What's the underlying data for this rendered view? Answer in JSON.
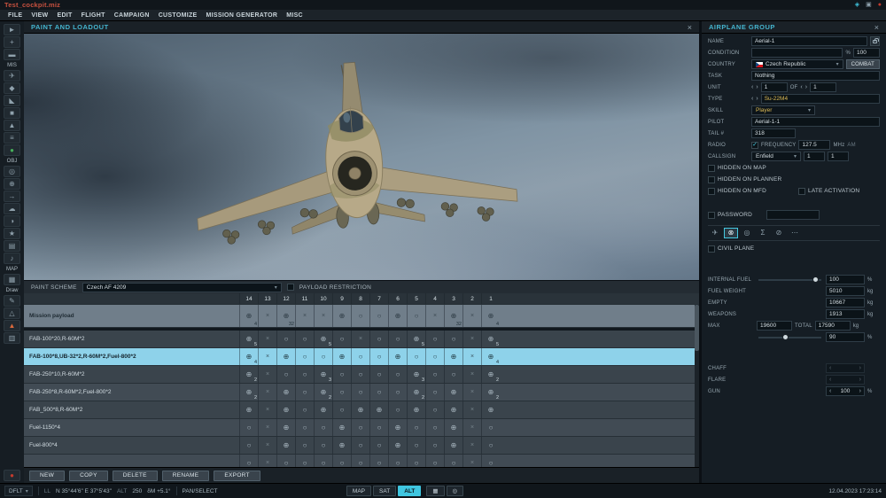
{
  "title_bar": {
    "title": "Test_cockpit.miz",
    "icons": [
      {
        "name": "network-status-icon",
        "glyph": "◈",
        "color": "#3fc6e0"
      },
      {
        "name": "voice-chat-icon",
        "glyph": "▣",
        "color": "#8fa1ac"
      },
      {
        "name": "record-indicator-icon",
        "glyph": "●",
        "color": "#c23b2e"
      }
    ]
  },
  "menu_bar": {
    "items": [
      "FILE",
      "VIEW",
      "EDIT",
      "FLIGHT",
      "CAMPAIGN",
      "CUSTOMIZE",
      "MISSION GENERATOR",
      "MISC"
    ]
  },
  "left_toolbar": {
    "items": [
      {
        "type": "icon",
        "name": "select-icon",
        "glyph": "►"
      },
      {
        "type": "icon",
        "name": "pan-icon",
        "glyph": "+"
      },
      {
        "type": "icon",
        "name": "ruler-icon",
        "glyph": "▬"
      },
      {
        "type": "label",
        "text": "MIS"
      },
      {
        "type": "icon",
        "name": "aircraft-icon",
        "glyph": "✈"
      },
      {
        "type": "icon",
        "name": "helicopter-icon",
        "glyph": "◆"
      },
      {
        "type": "icon",
        "name": "ship-icon",
        "glyph": "◣"
      },
      {
        "type": "icon",
        "name": "vehicle-icon",
        "glyph": "■"
      },
      {
        "type": "icon",
        "name": "static-object-icon",
        "glyph": "▲"
      },
      {
        "type": "icon",
        "name": "template-icon",
        "glyph": "≡"
      },
      {
        "type": "icon",
        "name": "play-icon",
        "glyph": "●",
        "color": "#46b05a"
      },
      {
        "type": "label",
        "text": "OBJ"
      },
      {
        "type": "icon",
        "name": "trigger-zone-icon",
        "glyph": "◎"
      },
      {
        "type": "icon",
        "name": "bullseye-icon",
        "glyph": "⊕"
      },
      {
        "type": "icon",
        "name": "route-icon",
        "glyph": "→"
      },
      {
        "type": "icon",
        "name": "weather-icon",
        "glyph": "☁"
      },
      {
        "type": "icon",
        "name": "time-icon",
        "glyph": "◑"
      },
      {
        "type": "icon",
        "name": "settings-icon",
        "glyph": "★"
      },
      {
        "type": "icon",
        "name": "briefing-icon",
        "glyph": "▤"
      },
      {
        "type": "icon",
        "name": "sound-icon",
        "glyph": "♪"
      },
      {
        "type": "label",
        "text": "MAP"
      },
      {
        "type": "icon",
        "name": "layers-icon",
        "glyph": "▦"
      },
      {
        "type": "label",
        "text": "Draw"
      },
      {
        "type": "icon",
        "name": "draw-pencil-icon",
        "glyph": "✎"
      },
      {
        "type": "icon",
        "name": "draw-shape-icon",
        "glyph": "△"
      },
      {
        "type": "icon",
        "name": "warning-icon",
        "glyph": "▲",
        "color": "#d8683c"
      },
      {
        "type": "icon",
        "name": "export-icon",
        "glyph": "▥"
      },
      {
        "type": "spacer"
      },
      {
        "type": "icon",
        "name": "record-icon",
        "glyph": "●",
        "color": "#c23b2e"
      }
    ]
  },
  "paint_panel": {
    "title": "PAINT AND LOADOUT",
    "paint_scheme_label": "PAINT SCHEME",
    "paint_scheme_value": "Czech AF 4209",
    "payload_restriction_label": "PAYLOAD RESTRICTION",
    "pylons": [
      "14",
      "13",
      "12",
      "11",
      "10",
      "9",
      "8",
      "7",
      "6",
      "5",
      "4",
      "3",
      "2",
      "1"
    ],
    "rows": [
      {
        "label": "Mission payload",
        "kind": "mission",
        "cells": [
          "w:4",
          "x",
          "w:32",
          "x",
          "x",
          "w",
          "c",
          "c",
          "w",
          "c",
          "x",
          "w:32",
          "x",
          "w:4"
        ]
      },
      {
        "label": "FAB-100*20,R-60M*2",
        "cells": [
          "w:5",
          "x",
          "c",
          "c",
          "w:5",
          "c",
          "x",
          "c",
          "c",
          "w:5",
          "c",
          "c",
          "x",
          "w:5"
        ]
      },
      {
        "label": "FAB-100*8,UB-32*2,R-60M*2,Fuel-800*2",
        "selected": true,
        "cells": [
          "w:4",
          "x",
          "w",
          "c",
          "c",
          "w",
          "c",
          "c",
          "w",
          "c",
          "c",
          "w",
          "x",
          "w:4"
        ]
      },
      {
        "label": "FAB-250*10,R-60M*2",
        "cells": [
          "w:2",
          "x",
          "c",
          "c",
          "w:3",
          "c",
          "c",
          "c",
          "c",
          "w:3",
          "c",
          "c",
          "x",
          "w:2"
        ]
      },
      {
        "label": "FAB-250*8,R-60M*2,Fuel-800*2",
        "cells": [
          "w:2",
          "x",
          "w",
          "c",
          "w:2",
          "c",
          "c",
          "c",
          "c",
          "w:2",
          "c",
          "w",
          "x",
          "w:2"
        ]
      },
      {
        "label": "FAB_500*8,R-60M*2",
        "cells": [
          "w",
          "x",
          "w",
          "c",
          "w",
          "c",
          "w",
          "w",
          "c",
          "w",
          "c",
          "w",
          "x",
          "w"
        ]
      },
      {
        "label": "Fuel-1150*4",
        "cells": [
          "c",
          "x",
          "w",
          "c",
          "c",
          "w",
          "c",
          "c",
          "w",
          "c",
          "c",
          "w",
          "x",
          "c"
        ]
      },
      {
        "label": "Fuel-800*4",
        "cells": [
          "c",
          "x",
          "w",
          "c",
          "c",
          "w",
          "c",
          "c",
          "w",
          "c",
          "c",
          "w",
          "x",
          "c"
        ]
      },
      {
        "label": "",
        "cells": [
          "c",
          "x",
          "c",
          "c",
          "c",
          "c",
          "c",
          "c",
          "c",
          "c",
          "c",
          "c",
          "x",
          "c"
        ]
      }
    ],
    "buttons": [
      {
        "label": "NEW",
        "name": "new-button"
      },
      {
        "label": "COPY",
        "name": "copy-button"
      },
      {
        "label": "DELETE",
        "name": "delete-button"
      },
      {
        "label": "RENAME",
        "name": "rename-button"
      },
      {
        "label": "EXPORT",
        "name": "export-button"
      }
    ]
  },
  "group_panel": {
    "title": "AIRPLANE GROUP",
    "name": {
      "label": "NAME",
      "value": "Aerial-1"
    },
    "condition": {
      "label": "CONDITION",
      "value": "",
      "percent_label": "%",
      "percent": "100"
    },
    "country": {
      "label": "COUNTRY",
      "value": "Czech Republic",
      "combat": "COMBAT"
    },
    "task": {
      "label": "TASK",
      "value": "Nothing"
    },
    "unit": {
      "label": "UNIT",
      "value": "1",
      "of_label": "OF",
      "count": "1"
    },
    "type": {
      "label": "TYPE",
      "value": "Su-22M4"
    },
    "skill": {
      "label": "SKILL",
      "value": "Player"
    },
    "pilot": {
      "label": "PILOT",
      "value": "Aerial-1-1"
    },
    "tail": {
      "label": "TAIL #",
      "value": "318"
    },
    "radio": {
      "label": "RADIO",
      "frequency_label": "FREQUENCY",
      "frequency": "127.5",
      "unit": "MHz",
      "mode": "AM"
    },
    "callsign": {
      "label": "CALLSIGN",
      "value": "Enfield",
      "num1": "1",
      "num2": "1"
    },
    "checkboxes": {
      "hidden_map": "HIDDEN ON MAP",
      "hidden_planner": "HIDDEN ON PLANNER",
      "hidden_mfd": "HIDDEN ON MFD",
      "late_activation": "LATE ACTIVATION",
      "password": "PASSWORD",
      "civil_plane": "CIVIL PLANE"
    },
    "tabs": [
      {
        "name": "tab-aircraft",
        "glyph": "✈"
      },
      {
        "name": "tab-loadout",
        "glyph": "⊗",
        "active": true
      },
      {
        "name": "tab-targeting",
        "glyph": "◎"
      },
      {
        "name": "tab-summary",
        "glyph": "Σ"
      },
      {
        "name": "tab-failures",
        "glyph": "⊘"
      },
      {
        "name": "tab-more",
        "glyph": "⋯"
      }
    ],
    "fuel": {
      "internal_label": "INTERNAL FUEL",
      "internal_value": "100",
      "internal_unit": "%",
      "weight_label": "FUEL WEIGHT",
      "weight_value": "5010",
      "weight_unit": "kg",
      "empty_label": "EMPTY",
      "empty_value": "10667",
      "empty_unit": "kg",
      "weapons_label": "WEAPONS",
      "weapons_value": "1913",
      "weapons_unit": "kg",
      "max_label": "MAX",
      "max_value": "19600",
      "total_label": "TOTAL",
      "total_value": "17590",
      "total_unit": "kg",
      "load_value": "90",
      "load_unit": "%"
    },
    "countermeasures": {
      "chaff_label": "CHAFF",
      "chaff_value": "",
      "flare_label": "FLARE",
      "flare_value": "",
      "gun_label": "GUN",
      "gun_value": "100",
      "gun_unit": "%"
    }
  },
  "status_bar": {
    "preset": "DFLT",
    "coords_label": "LL",
    "coords": "N 35°44'6\"  E 37°5'43\"",
    "alt_label": "ALT",
    "alt_value": "250",
    "mag": "δM +5.1°",
    "mode": "PAN/SELECT",
    "map_buttons": [
      {
        "label": "MAP"
      },
      {
        "label": "SAT"
      },
      {
        "label": "ALT",
        "active": true
      }
    ],
    "tool_icons": [
      {
        "name": "layers-button-icon",
        "glyph": "▦"
      },
      {
        "name": "measure-button-icon",
        "glyph": "◎"
      }
    ],
    "datetime": "12.04.2023 17:23:14"
  },
  "icons": {
    "close": "×",
    "caret": "▾",
    "left": "‹",
    "right": "›",
    "check": "✓"
  }
}
